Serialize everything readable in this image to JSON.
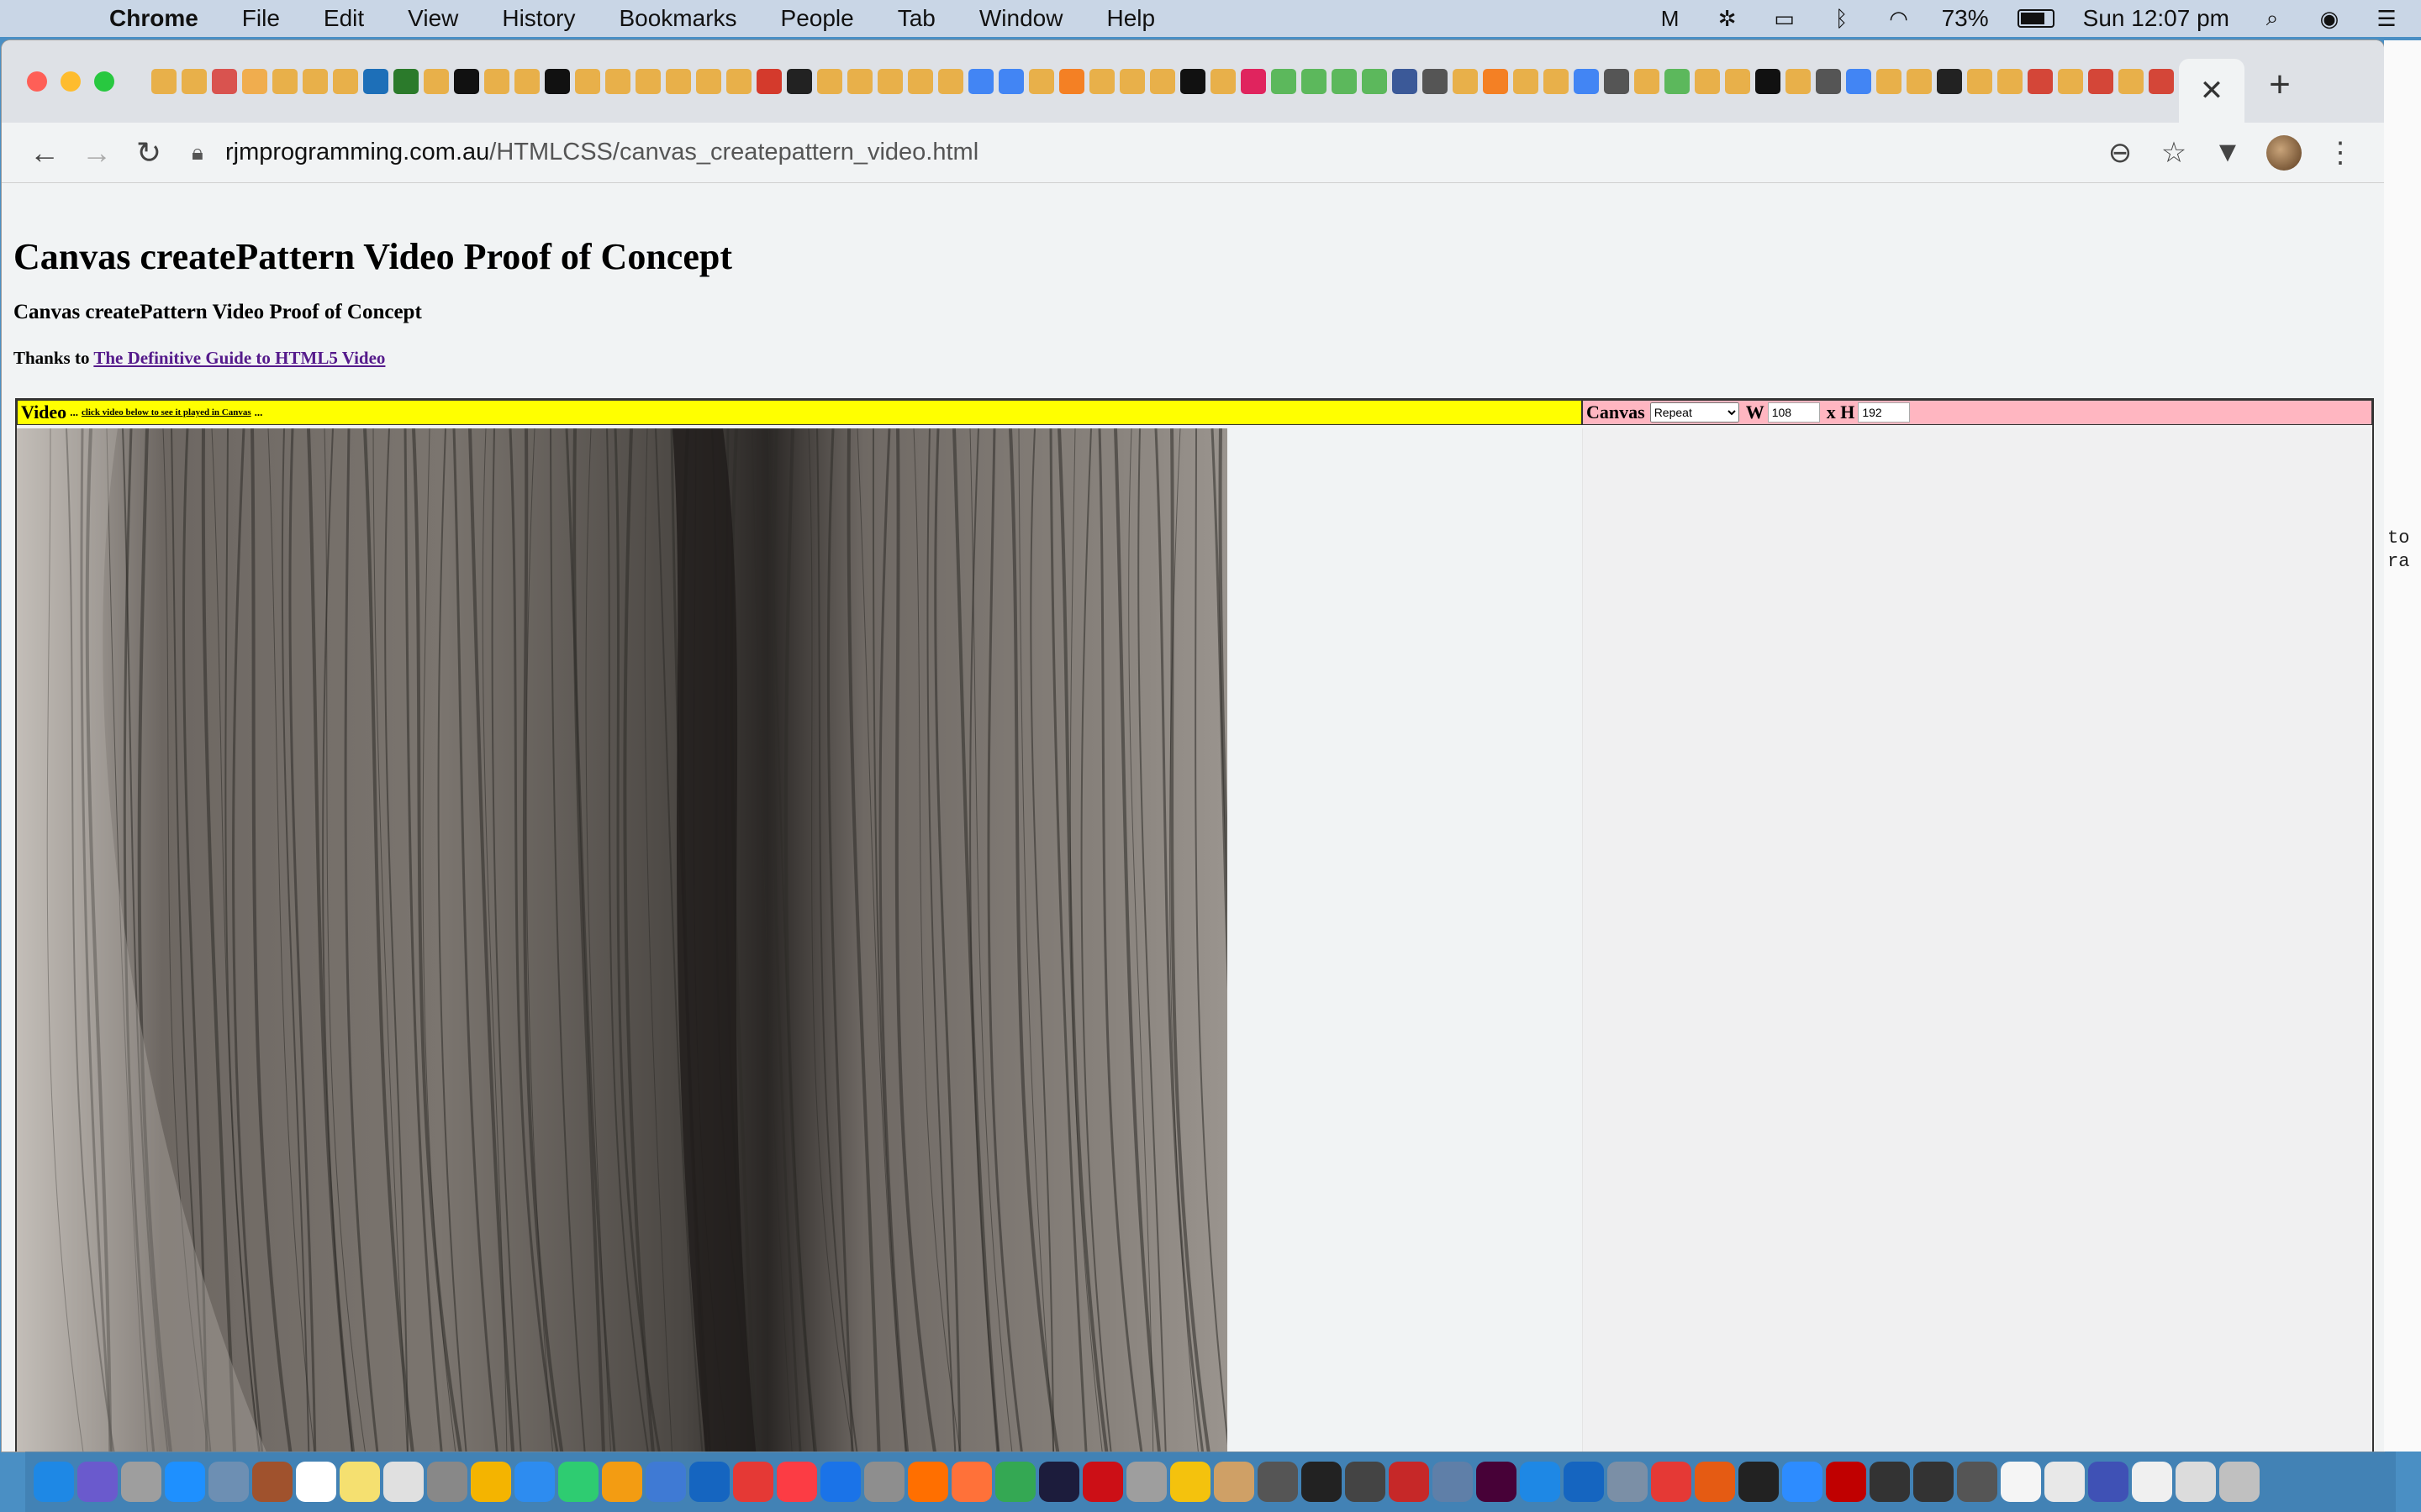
{
  "menubar": {
    "app": "Chrome",
    "items": [
      "File",
      "Edit",
      "View",
      "History",
      "Bookmarks",
      "People",
      "Tab",
      "Window",
      "Help"
    ],
    "battery_percent": "73%",
    "clock": "Sun 12:07 pm"
  },
  "browser": {
    "url_host": "rjmprogramming.com.au",
    "url_path": "/HTMLCSS/canvas_createpattern_video.html",
    "tab_favicon_colors": [
      "#e8b04a",
      "#e8b04a",
      "#d9534f",
      "#f0ad4e",
      "#e8b04a",
      "#e8b04a",
      "#e8b04a",
      "#1d6fb8",
      "#2b7a2b",
      "#e8b04a",
      "#111111",
      "#e8b04a",
      "#e8b04a",
      "#111111",
      "#e8b04a",
      "#e8b04a",
      "#e8b04a",
      "#e8b04a",
      "#e8b04a",
      "#e8b04a",
      "#d43a2c",
      "#222222",
      "#e8b04a",
      "#e8b04a",
      "#e8b04a",
      "#e8b04a",
      "#e8b04a",
      "#4285f4",
      "#4285f4",
      "#e8b04a",
      "#f48024",
      "#e8b04a",
      "#e8b04a",
      "#e8b04a",
      "#111111",
      "#e8b04a",
      "#e0245e",
      "#5cb85c",
      "#5cb85c",
      "#5cb85c",
      "#5cb85c",
      "#3b5998",
      "#555555",
      "#e8b04a",
      "#f48024",
      "#e8b04a",
      "#e8b04a",
      "#4285f4",
      "#555555",
      "#e8b04a",
      "#5cb85c",
      "#e8b04a",
      "#e8b04a",
      "#111111",
      "#e8b04a",
      "#555555",
      "#4285f4",
      "#e8b04a",
      "#e8b04a",
      "#222222",
      "#e8b04a",
      "#e8b04a",
      "#d44638",
      "#e8b04a",
      "#d44638",
      "#e8b04a",
      "#d44638",
      "#3b5998",
      "#e8b04a"
    ]
  },
  "page": {
    "h1": "Canvas createPattern Video Proof of Concept",
    "h3": "Canvas createPattern Video Proof of Concept",
    "thanks_prefix": "Thanks to ",
    "thanks_link": "The Definitive Guide to HTML5 Video",
    "video_header": {
      "title": "Video",
      "separator_left": "...",
      "link": "click video below to see it played in Canvas",
      "separator_right": "..."
    },
    "canvas_header": {
      "title": "Canvas",
      "pattern_selected": "Repeat",
      "pattern_options": [
        "Repeat"
      ],
      "width_label": "W",
      "width_value": "108",
      "height_label": "x H",
      "height_value": "192"
    }
  },
  "right_edge_text": [
    "to",
    "ra"
  ],
  "dock_icon_colors": [
    "#1e88e5",
    "#6a5acd",
    "#9e9e9e",
    "#1e90ff",
    "#6d8fb3",
    "#a0522d",
    "#ffffff",
    "#f5e070",
    "#e0e0e0",
    "#888888",
    "#f4b400",
    "#2d8cf0",
    "#2ecc71",
    "#f39c12",
    "#3f7ad4",
    "#1565c0",
    "#e53935",
    "#fc3c44",
    "#1a73e8",
    "#8e8e8e",
    "#ff6f00",
    "#ff7139",
    "#34a853",
    "#1c1c3c",
    "#cc0f16",
    "#9e9e9e",
    "#f4c20d",
    "#cfa066",
    "#555555",
    "#222222",
    "#444444",
    "#c62828",
    "#5f7fa8",
    "#470137",
    "#1e88e5",
    "#1565c0",
    "#7b8fa6",
    "#e53935",
    "#e55b13",
    "#222222",
    "#2d8cff",
    "#c00000",
    "#333333",
    "#333333",
    "#555555",
    "#f5f5f5",
    "#e8e8e8",
    "#3f51b5",
    "#f0f0f0",
    "#dcdcdc",
    "#c0c0c0"
  ]
}
